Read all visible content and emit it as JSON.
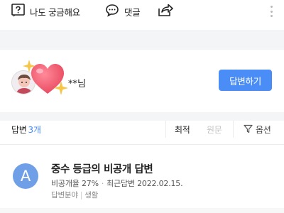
{
  "actions": {
    "curious_label": "나도 궁금해요",
    "comment_label": "댓글"
  },
  "prompt": {
    "user_name": "**님",
    "answer_button": "답변하기"
  },
  "answers_header": {
    "label": "답변",
    "count": "3개",
    "sort_latest": "최적",
    "sort_original": "원문",
    "options": "옵션"
  },
  "answer": {
    "avatar_letter": "A",
    "title": "중수 등급의 비공개 답변",
    "private_rate": "비공개율 27%",
    "recent_answer": "최근답변 2022.02.15.",
    "field_label": "답변분야",
    "field_value": "생활"
  },
  "colors": {
    "accent": "#4a8df6",
    "avatar_bg": "#6f9fe6",
    "heart": "#e8475d",
    "sparkle": "#f5c64a"
  }
}
